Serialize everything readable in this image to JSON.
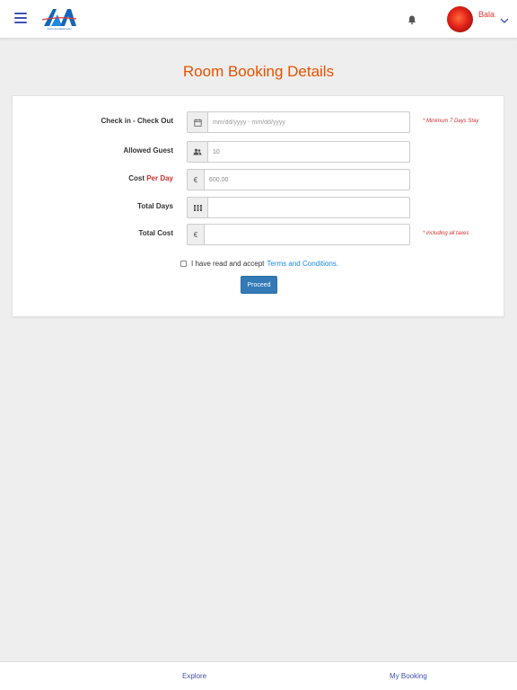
{
  "header": {
    "menu_icon": "hamburger-menu-icon",
    "logo_text": "AccommodationsAU",
    "bell_icon": "bell-icon",
    "username": "Bala",
    "caret_icon": "chevron-down-icon",
    "accent_color": "#3f51b5"
  },
  "page": {
    "title": "Room Booking Details",
    "title_color": "#e65100"
  },
  "form": {
    "checkin": {
      "label": "Check in - Check Out",
      "icon": "calendar-icon",
      "placeholder": "mm/dd/yyyy - mm/dd/yyyy",
      "value": "",
      "note": "* Minimum 7 Days Stay"
    },
    "guest": {
      "label": "Allowed Guest",
      "icon": "users-icon",
      "value": "10"
    },
    "cost_per_day": {
      "label_prefix": "Cost ",
      "label_accent": "Per Day",
      "icon_glyph": "€",
      "icon": "euro-icon",
      "value": "600.00"
    },
    "total_days": {
      "label": "Total Days",
      "icon": "grid-icon",
      "value": ""
    },
    "total_cost": {
      "label": "Total Cost",
      "icon_glyph": "€",
      "icon": "euro-icon",
      "value": "",
      "note": "* including all taxes"
    },
    "terms": {
      "text": "I have read and accept",
      "link": "Terms and Conditions."
    },
    "proceed_label": "Proceed",
    "button_color": "#337ab7"
  },
  "bottom_nav": {
    "explore": "Explore",
    "my_booking": "My Booking"
  }
}
